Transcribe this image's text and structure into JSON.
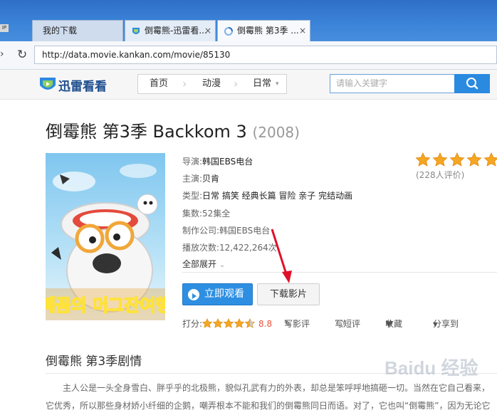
{
  "browser": {
    "ie_badge": "IP",
    "tabs": [
      {
        "label": "我的下载"
      },
      {
        "label": "倒霉熊-迅雷看...",
        "close": "×"
      },
      {
        "label": "倒霉熊 第3季 ...",
        "close": "×"
      }
    ],
    "url": "http://data.movie.kankan.com/movie/85130"
  },
  "site": {
    "logo_text": "迅雷看看",
    "breadcrumb": [
      "首页",
      "动漫",
      "日常"
    ],
    "search_placeholder": "请输入关键字"
  },
  "movie": {
    "title": "倒霉熊 第3季 Backkom 3",
    "year": "(2008)",
    "info": [
      {
        "label": "导演:",
        "value": "韩国EBS电台"
      },
      {
        "label": "主演:",
        "value": "贝肯"
      },
      {
        "label": "类型:",
        "value": "日常 搞笑 经典长篇 冒险 亲子 完结动画"
      },
      {
        "label": "集数:",
        "value": "52集全"
      },
      {
        "label": "制作公司:",
        "value": "韩国EBS电台"
      },
      {
        "label": "播放次数:",
        "value": "12,422,264次"
      }
    ],
    "expand_all": "全部展开",
    "rating_stars": 5,
    "review_count": "(228人评价)",
    "watch_button": "立即观看",
    "download_button": "下载影片",
    "score_label": "打分:",
    "score": "8.8",
    "score_stars": 4.5,
    "actions": {
      "write_review": "写影评",
      "write_short": "写短评",
      "favorite": "收藏",
      "share": "分享到"
    },
    "poster_title": "빼꼼의 머그잔여행",
    "section_title": "倒霉熊 第3季剧情",
    "synopsis": "主人公是一头全身雪白、胖乎乎的北极熊，貌似孔武有力的外表，却总是笨呼呼地搞砸一切。当然在它自己看来，它优秀，所以那些身材娇小纤细的企鹅，嘲弄根本不能和我们的倒霉熊同日而语。对了，它也叫“倒霉熊”，因为无论它"
  },
  "watermark": "Baidu 经验",
  "colors": {
    "accent_blue": "#2e8fe2",
    "star": "#f5a623",
    "score": "#e8553a",
    "arrow": "#e0102a"
  }
}
